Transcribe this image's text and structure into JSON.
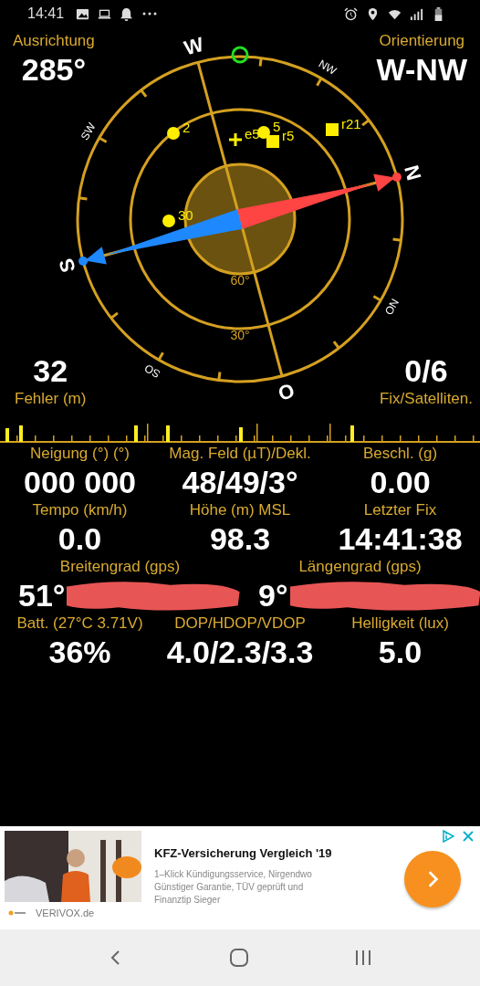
{
  "status_bar": {
    "time": "14:41"
  },
  "header": {
    "left": {
      "label": "Ausrichtung",
      "value": "285°"
    },
    "right": {
      "label": "Orientierung",
      "value": "W-NW"
    }
  },
  "compass": {
    "directions": [
      {
        "label": "N",
        "kind": "major"
      },
      {
        "label": "NO",
        "kind": "minor"
      },
      {
        "label": "O",
        "kind": "major"
      },
      {
        "label": "SO",
        "kind": "minor"
      },
      {
        "label": "S",
        "kind": "major"
      },
      {
        "label": "SW",
        "kind": "minor"
      },
      {
        "label": "W",
        "kind": "major"
      },
      {
        "label": "NW",
        "kind": "minor"
      }
    ],
    "rings": [
      "60°",
      "30°"
    ],
    "satellites": [
      {
        "label": "2",
        "kind": "dot"
      },
      {
        "label": "e5",
        "kind": "cross"
      },
      {
        "label": "5",
        "kind": "dot"
      },
      {
        "label": "r5",
        "kind": "square"
      },
      {
        "label": "r21",
        "kind": "square"
      },
      {
        "label": "30",
        "kind": "dot"
      }
    ]
  },
  "footer": {
    "left": {
      "value": "32",
      "label": "Fehler (m)"
    },
    "right": {
      "value": "0/6",
      "label": "Fix/Satelliten."
    }
  },
  "rows": [
    [
      {
        "label": "Neigung (°) (°)",
        "value": "000 000",
        "redacted": false
      },
      {
        "label": "Mag. Feld (µT)/Dekl.",
        "value": "48/49/3°",
        "redacted": false
      },
      {
        "label": "Beschl. (g)",
        "value": "0.00",
        "redacted": false
      }
    ],
    [
      {
        "label": "Tempo (km/h)",
        "value": "0.0",
        "redacted": false
      },
      {
        "label": "Höhe (m) MSL",
        "value": "98.3",
        "redacted": false
      },
      {
        "label": "Letzter Fix",
        "value": "14:41:38",
        "redacted": false
      }
    ],
    [
      {
        "label": "Breitengrad (gps)",
        "value": "51°",
        "redacted": true
      },
      {
        "label": "Längengrad (gps)",
        "value": "9°",
        "redacted": true
      }
    ],
    [
      {
        "label": "Batt. (27°C 3.71V)",
        "value": "36%",
        "redacted": false
      },
      {
        "label": "DOP/HDOP/VDOP",
        "value": "4.0/2.3/3.3",
        "redacted": false
      },
      {
        "label": "Helligkeit (lux)",
        "value": "5.0",
        "redacted": false
      }
    ]
  ],
  "ad": {
    "title": "KFZ-Versicherung Vergleich '19",
    "description": "1–Klick Kündigungsservice, Nirgendwo Günstiger Garantie, TÜV geprüft und Finanztip Sieger",
    "advertiser": "VERIVOX.de"
  }
}
